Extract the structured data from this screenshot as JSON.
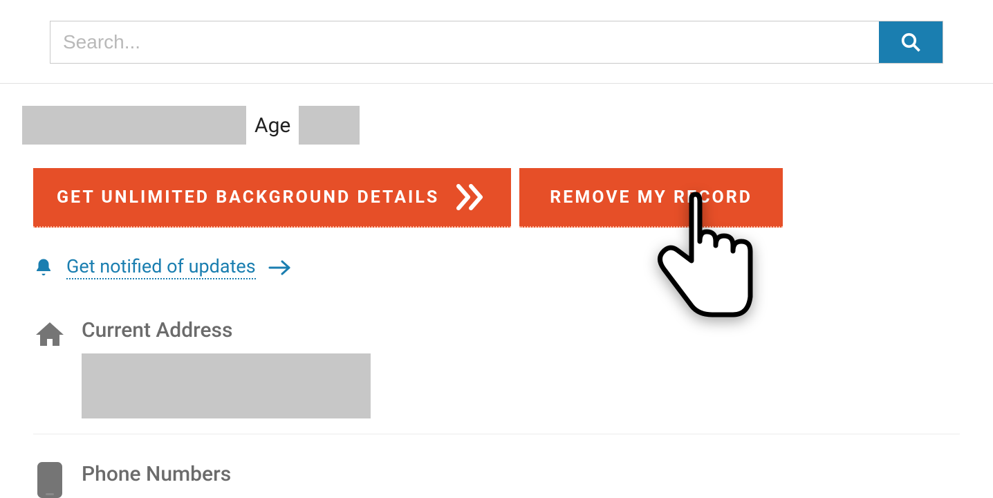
{
  "search": {
    "placeholder": "Search...",
    "value": ""
  },
  "profile": {
    "age_label": "Age"
  },
  "buttons": {
    "background_details": "GET UNLIMITED BACKGROUND DETAILS",
    "remove_record": "REMOVE MY RECORD"
  },
  "notify": {
    "link_text": "Get notified of updates"
  },
  "sections": {
    "current_address": "Current Address",
    "phone_numbers": "Phone Numbers"
  }
}
